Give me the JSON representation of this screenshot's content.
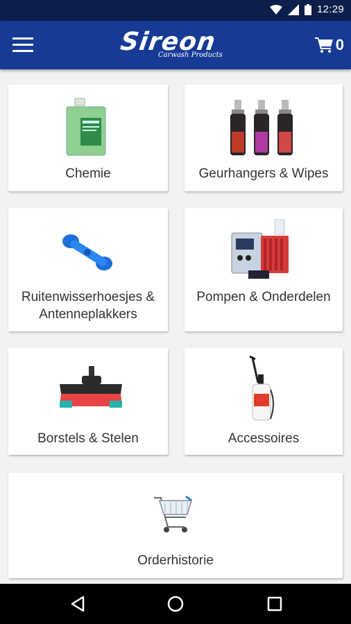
{
  "status_bar": {
    "time": "12:29"
  },
  "app_bar": {
    "logo_text": "Sireon",
    "logo_tagline": "Carwash Products",
    "cart_count": "0"
  },
  "categories": [
    {
      "label": "Chemie"
    },
    {
      "label": "Geurhangers & Wipes"
    },
    {
      "label_line1": "Ruitenwisserhoesjes &",
      "label_line2": "Antenneplakkers"
    },
    {
      "label": "Pompen & Onderdelen"
    },
    {
      "label": "Borstels & Stelen"
    },
    {
      "label": "Accessoires"
    },
    {
      "label": "Orderhistorie"
    }
  ],
  "colors": {
    "app_bar": "#173b95",
    "status_bar": "#0d1e4a",
    "background": "#f2f2f2"
  },
  "icons": [
    "wifi-icon",
    "signal-icon",
    "battery-icon",
    "menu-icon",
    "cart-icon",
    "back-icon",
    "home-icon",
    "recents-icon"
  ]
}
